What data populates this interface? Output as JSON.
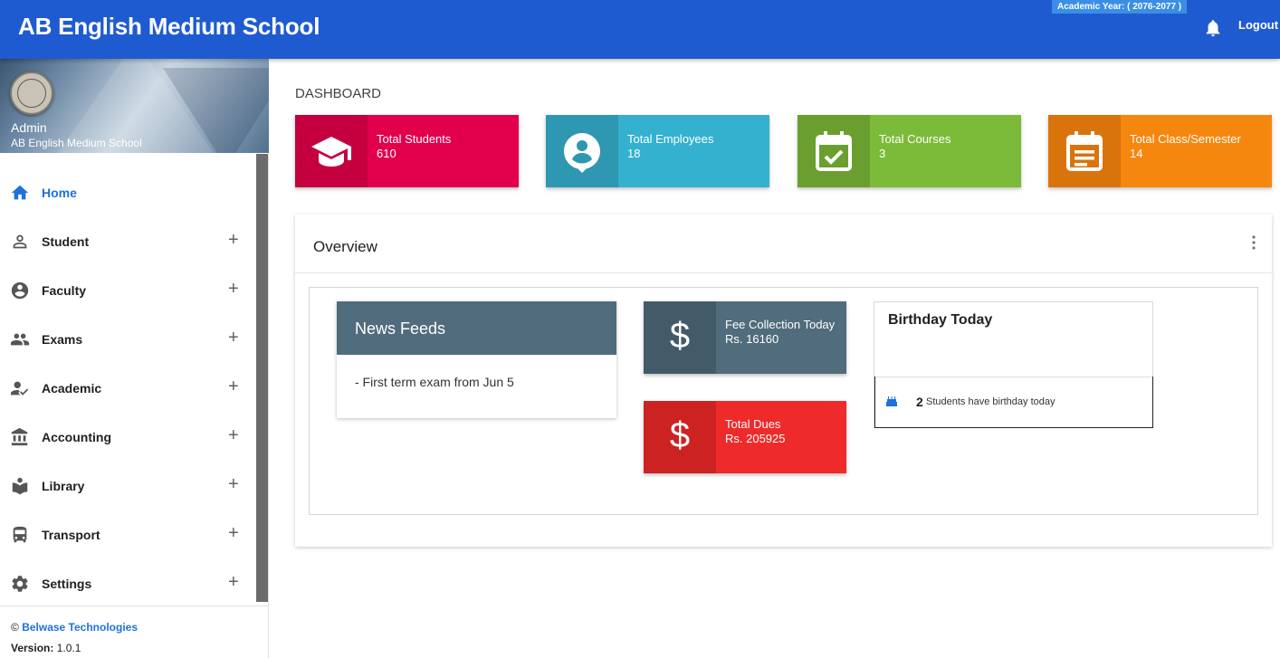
{
  "header": {
    "app_title": "AB English Medium School",
    "academic_year": "Academic Year: ( 2076-2077 )",
    "notification_icon": "bell-icon",
    "logout_label": "Logout",
    "bar_color": "#1f5bd0"
  },
  "sidebar": {
    "profile": {
      "name": "Admin",
      "school": "AB English Medium School"
    },
    "items": [
      {
        "label": "Home",
        "icon": "home-icon",
        "active": true
      },
      {
        "label": "Student",
        "icon": "person-icon",
        "expand": "+"
      },
      {
        "label": "Faculty",
        "icon": "account-circle-icon",
        "expand": "+"
      },
      {
        "label": "Exams",
        "icon": "people-icon",
        "expand": "+"
      },
      {
        "label": "Academic",
        "icon": "person-check-icon",
        "expand": "+"
      },
      {
        "label": "Accounting",
        "icon": "bank-icon",
        "expand": "+"
      },
      {
        "label": "Library",
        "icon": "book-reader-icon",
        "expand": "+"
      },
      {
        "label": "Transport",
        "icon": "bus-icon",
        "expand": "+"
      },
      {
        "label": "Settings",
        "icon": "gear-icon",
        "expand": "+"
      }
    ],
    "footer": {
      "copyright_symbol": "©",
      "company": "Belwase Technologies",
      "version_label": "Version:",
      "version_value": "1.0.1"
    }
  },
  "main": {
    "page_title": "DASHBOARD",
    "stats": [
      {
        "label": "Total Students",
        "value": "610",
        "icon": "graduation-cap-icon",
        "color": "#e2004d",
        "icon_bg": "#c4003f"
      },
      {
        "label": "Total Employees",
        "value": "18",
        "icon": "employee-pin-icon",
        "color": "#34b1cf",
        "icon_bg": "#2e97b1"
      },
      {
        "label": "Total Courses",
        "value": "3",
        "icon": "calendar-check-icon",
        "color": "#7cbb3a",
        "icon_bg": "#6a9f30"
      },
      {
        "label": "Total Class/Semester",
        "value": "14",
        "icon": "document-icon",
        "color": "#f5870f",
        "icon_bg": "#d9740c"
      }
    ],
    "overview": {
      "title": "Overview",
      "menu_icon": "more-vert-icon",
      "news": {
        "title": "News Feeds",
        "items": [
          "- First term exam from Jun 5"
        ]
      },
      "fees": [
        {
          "label": "Fee Collection Today",
          "value": "Rs. 16160",
          "symbol": "$",
          "icon": "dollar-icon",
          "color": "#516c7c",
          "icon_bg": "#435b69"
        },
        {
          "label": "Total Dues",
          "value": "Rs. 205925",
          "symbol": "$",
          "icon": "dollar-icon",
          "color": "#ee2a2a",
          "icon_bg": "#cc2222"
        }
      ],
      "birthday": {
        "title": "Birthday Today",
        "icon": "cake-icon",
        "count": "2",
        "text": "Students have birthday today"
      }
    }
  }
}
